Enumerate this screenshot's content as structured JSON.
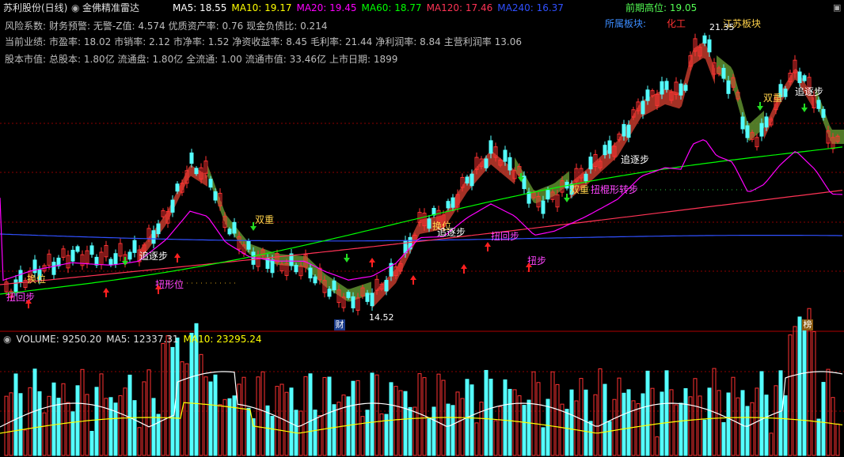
{
  "header": {
    "stock_name": "苏利股份(日线)",
    "indicator_name": "金佛精准雷达",
    "ma": [
      {
        "label": "MA5: 18.55",
        "color": "#ffffff"
      },
      {
        "label": "MA10: 19.17",
        "color": "#ffff00"
      },
      {
        "label": "MA20: 19.45",
        "color": "#ff00ff"
      },
      {
        "label": "MA60: 18.77",
        "color": "#00ff00"
      },
      {
        "label": "MA120: 17.46",
        "color": "#ff3355"
      },
      {
        "label": "MA240: 16.37",
        "color": "#3050ff"
      }
    ],
    "prior_high_label": "前期高位: 19.05",
    "sector_label": "所属板块:",
    "sector_value": "化工",
    "region_label": "江苏板块"
  },
  "info_lines": [
    [
      "风险系数:",
      "财务预警: 无警-Z值: 4.574",
      "优质资产率: 0.76",
      "现金负债比: 0.214"
    ],
    [
      "当前业绩:",
      "市盈率: 18.02",
      "市销率: 2.12",
      "市净率: 1.52",
      "净资收益率: 8.45",
      "毛利率: 21.44",
      "净利润率: 8.84",
      "主营利润率 13.06"
    ],
    [
      "股本市值:",
      "总股本: 1.80亿",
      "流通盘: 1.80亿",
      "全流通: 1.00",
      "流通市值: 33.46亿",
      "上市日期: 1899"
    ]
  ],
  "volume_header": {
    "volume": "VOLUME: 9250.20",
    "ma5": "MA5: 12337.31",
    "ma10": "MA10: 23295.24"
  },
  "badges": {
    "left": "财",
    "right": "榜"
  },
  "colors": {
    "up": "#ff3232",
    "down": "#54ffff",
    "band_bull": "#c0392b",
    "band_bear": "#5f8f2f",
    "ma5": "#ffffff",
    "ma10": "#ffff00",
    "ma20": "#ff00ff",
    "ma60": "#00ff00",
    "ma120": "#ff3355",
    "ma240": "#3050ff",
    "grid": "#8b0000"
  },
  "chart_data": {
    "type": "candlestick",
    "price_annotations": {
      "high": "21.35",
      "low": "14.52"
    },
    "signals": [
      {
        "text": "换位",
        "color": "#ffd24a"
      },
      {
        "text": "扭回步",
        "color": "#ff44ff"
      },
      {
        "text": "扭形位",
        "color": "#ff44ff"
      },
      {
        "text": "追逐步",
        "color": "#ffffff"
      },
      {
        "text": "双重",
        "color": "#ffd24a"
      },
      {
        "text": "换位",
        "color": "#ffd24a"
      },
      {
        "text": "追逐步",
        "color": "#ffffff"
      },
      {
        "text": "扭回步",
        "color": "#ff44ff"
      },
      {
        "text": "扭步",
        "color": "#ff44ff"
      },
      {
        "text": "双重",
        "color": "#ffd24a"
      },
      {
        "text": "扭棍形转步",
        "color": "#ff44ff"
      },
      {
        "text": "追逐步",
        "color": "#ffffff"
      },
      {
        "text": "双重",
        "color": "#ffd24a"
      },
      {
        "text": "追逐步",
        "color": "#ffffff"
      }
    ]
  }
}
